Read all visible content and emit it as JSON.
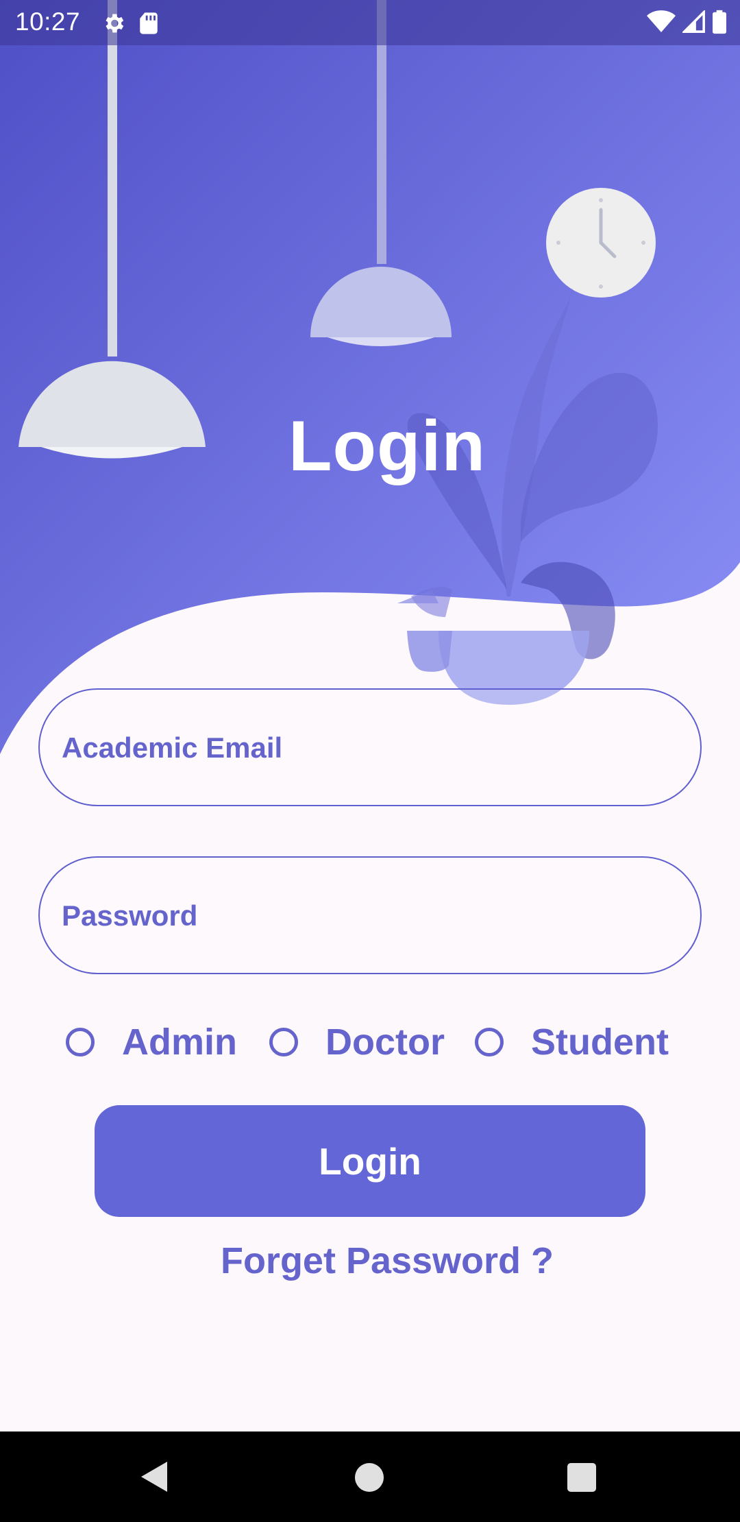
{
  "status_bar": {
    "time": "10:27",
    "left_icons": [
      "settings-icon",
      "sd-card-icon"
    ],
    "right_icons": [
      "wifi-icon",
      "signal-icon",
      "battery-icon"
    ]
  },
  "colors": {
    "accent": "#6366d6",
    "hero_gradient_start": "#4f4fc6",
    "hero_gradient_end": "#8c91f7",
    "background": "#fdf8fc"
  },
  "header": {
    "title": "Login"
  },
  "form": {
    "email": {
      "placeholder": "Academic Email",
      "value": ""
    },
    "password": {
      "placeholder": "Password",
      "value": ""
    }
  },
  "roles": {
    "options": [
      {
        "label": "Admin",
        "selected": false
      },
      {
        "label": "Doctor",
        "selected": false
      },
      {
        "label": "Student",
        "selected": false
      }
    ]
  },
  "actions": {
    "login_label": "Login",
    "forget_password_label": "Forget Password ?"
  },
  "nav_bar": {
    "icons": [
      "back-icon",
      "home-icon",
      "recents-icon"
    ]
  }
}
